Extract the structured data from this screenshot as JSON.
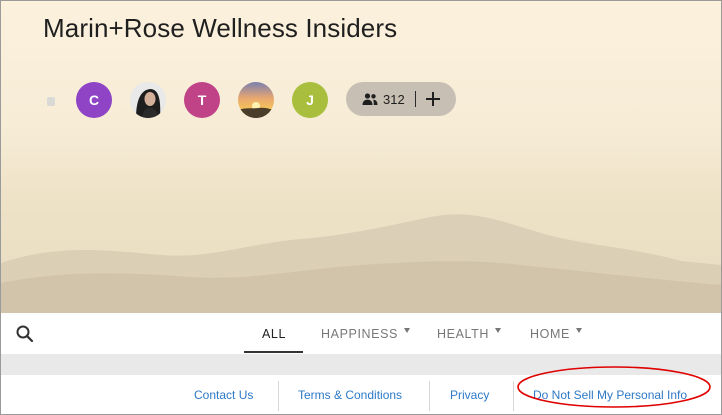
{
  "group": {
    "title": "Marin+Rose Wellness Insiders"
  },
  "members": {
    "avatars": [
      {
        "initial": "C",
        "color": "#8e44c4"
      },
      {
        "initial": "",
        "kind": "photo-person"
      },
      {
        "initial": "T",
        "color": "#c04388"
      },
      {
        "initial": "",
        "kind": "photo-sunset"
      },
      {
        "initial": "J",
        "color": "#a9be3c"
      }
    ],
    "count": "312",
    "people_icon": "people-icon",
    "add_icon": "plus-icon"
  },
  "nav": {
    "search_icon": "search-icon",
    "tabs": [
      {
        "label": "ALL",
        "active": true
      },
      {
        "label": "HAPPINESS",
        "dropdown": true
      },
      {
        "label": "HEALTH",
        "dropdown": true
      },
      {
        "label": "HOME",
        "dropdown": true
      }
    ]
  },
  "footer": {
    "links": [
      "Contact Us",
      "Terms & Conditions",
      "Privacy",
      "Do Not Sell My Personal Info"
    ],
    "highlight_color": "#e00000"
  }
}
